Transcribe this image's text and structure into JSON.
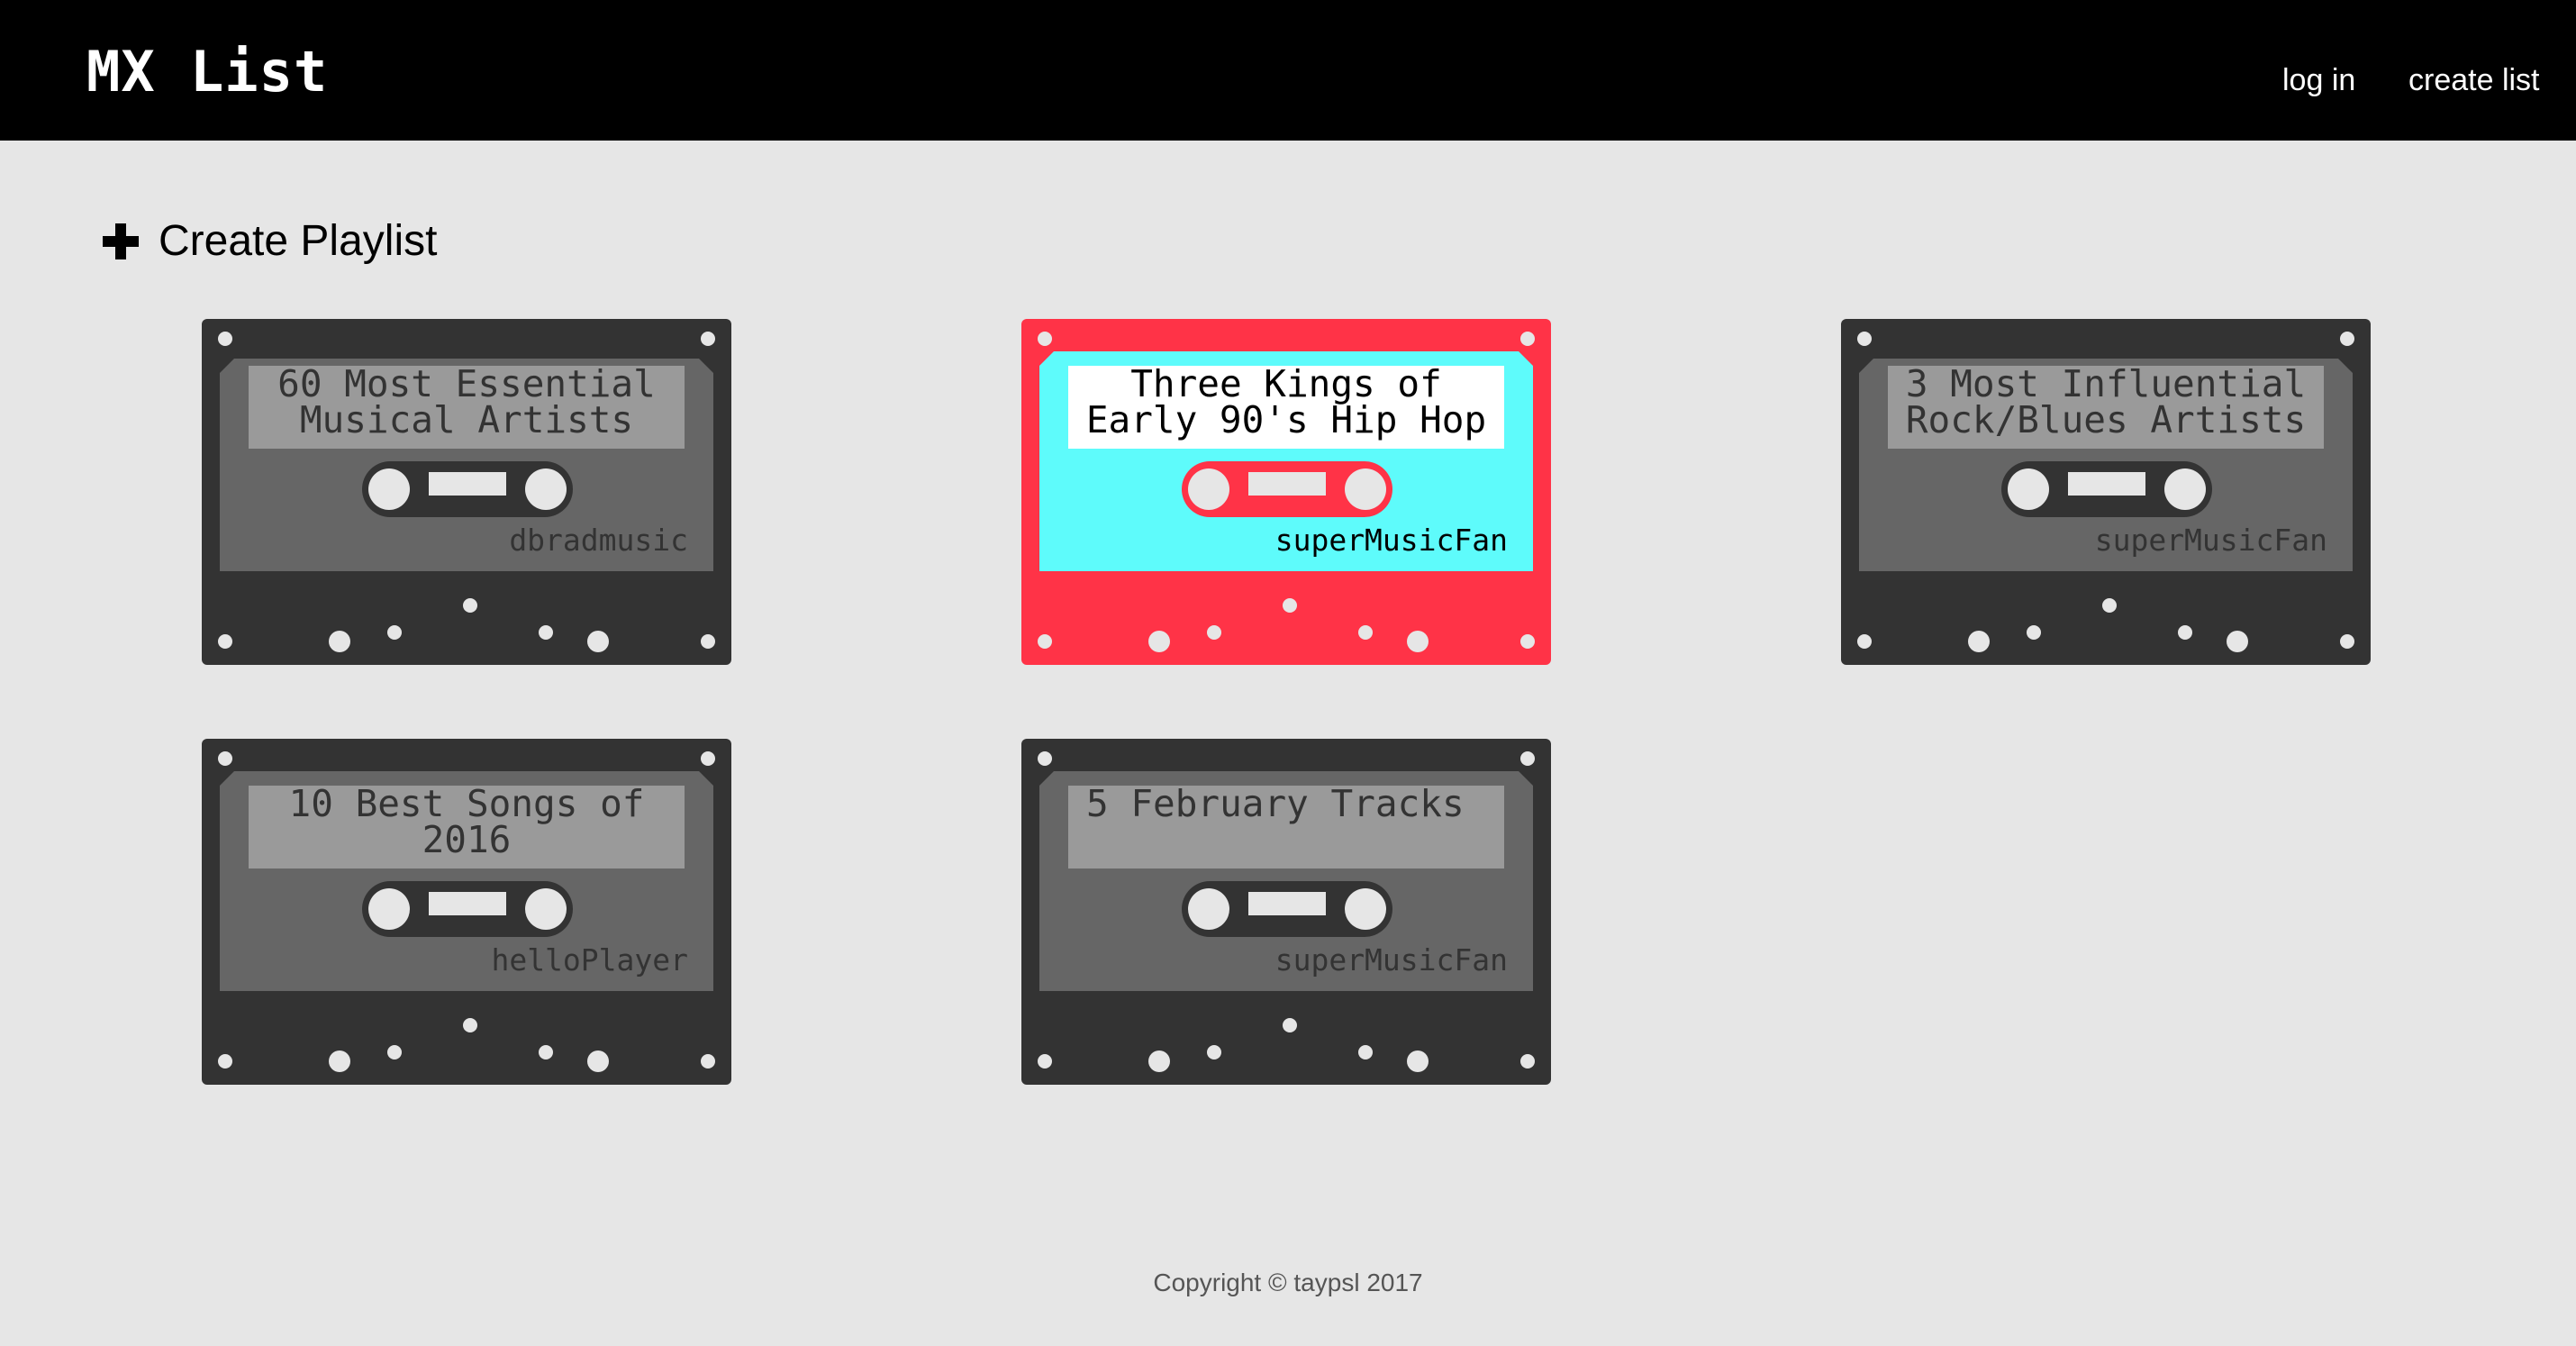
{
  "header": {
    "brand": "MX List",
    "nav": {
      "login": "log in",
      "create_list": "create list"
    }
  },
  "actions": {
    "create_playlist": "Create Playlist"
  },
  "playlists": [
    {
      "title": "60 Most Essential Musical Artists",
      "user": "dbradmusic"
    },
    {
      "title": "Three Kings of Early 90's Hip Hop",
      "user": "superMusicFan"
    },
    {
      "title": "3 Most Influential Rock/Blues Artists",
      "user": "superMusicFan"
    },
    {
      "title": "10 Best Songs of 2016",
      "user": "helloPlayer"
    },
    {
      "title": "5 February Tracks",
      "user": "superMusicFan"
    }
  ],
  "footer": {
    "copyright": "Copyright © taypsl 2017"
  },
  "colors": {
    "header_bg": "#000000",
    "page_bg": "#e6e6e6",
    "tape_body": "#333333",
    "tape_face": "#666666",
    "tape_label": "#9a9a9a",
    "active_body": "#ff3347",
    "active_face": "#5efbfb",
    "active_label": "#ffffff"
  }
}
